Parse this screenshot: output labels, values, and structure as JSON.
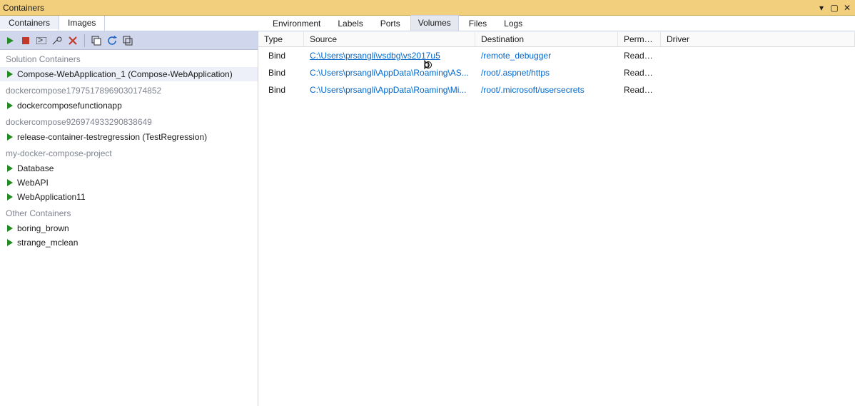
{
  "window": {
    "title": "Containers"
  },
  "leftTabs": {
    "containers": "Containers",
    "images": "Images"
  },
  "rightTabs": {
    "environment": "Environment",
    "labels": "Labels",
    "ports": "Ports",
    "volumes": "Volumes",
    "files": "Files",
    "logs": "Logs"
  },
  "sidebar": {
    "groups": [
      {
        "header": "Solution Containers",
        "items": [
          {
            "label": "Compose-WebApplication_1 (Compose-WebApplication)",
            "selected": true
          }
        ]
      },
      {
        "header": "dockercompose17975178969030174852",
        "items": [
          {
            "label": "dockercomposefunctionapp"
          }
        ]
      },
      {
        "header": "dockercompose926974933290838649",
        "items": [
          {
            "label": "release-container-testregression (TestRegression)"
          }
        ]
      },
      {
        "header": "my-docker-compose-project",
        "items": [
          {
            "label": "Database"
          },
          {
            "label": "WebAPI"
          },
          {
            "label": "WebApplication11"
          }
        ]
      },
      {
        "header": "Other Containers",
        "items": [
          {
            "label": "boring_brown"
          },
          {
            "label": "strange_mclean"
          }
        ]
      }
    ]
  },
  "volumes": {
    "columns": {
      "type": "Type",
      "source": "Source",
      "destination": "Destination",
      "permissions": "Permis...",
      "driver": "Driver"
    },
    "rows": [
      {
        "type": "Bind",
        "source": "C:\\Users\\prsangli\\vsdbg\\vs2017u5",
        "destination": "/remote_debugger",
        "permissions": "Read write",
        "driver": "",
        "hover": true
      },
      {
        "type": "Bind",
        "source": "C:\\Users\\prsangli\\AppData\\Roaming\\AS...",
        "destination": "/root/.aspnet/https",
        "permissions": "Read only",
        "driver": ""
      },
      {
        "type": "Bind",
        "source": "C:\\Users\\prsangli\\AppData\\Roaming\\Mi...",
        "destination": "/root/.microsoft/usersecrets",
        "permissions": "Read only",
        "driver": ""
      }
    ]
  }
}
